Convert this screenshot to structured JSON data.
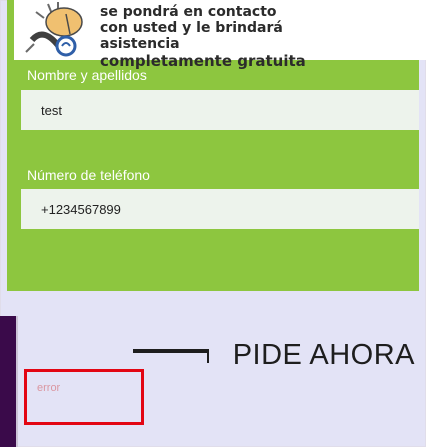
{
  "header": {
    "line1": "se pondrá en contacto",
    "line2": "con usted y le brindará",
    "line3": "asistencia",
    "line4": "completamente gratuita"
  },
  "form": {
    "name_label": "Nombre y apellidos",
    "name_value": "test",
    "phone_label": "Número de teléfono",
    "phone_value": "+1234567899",
    "submit_label": "PIDE AHORA"
  },
  "overlay": {
    "ghost_text": "error"
  },
  "colors": {
    "form_background": "#8dc63f",
    "field_background": "#edf3ec",
    "highlight_border": "#e30613",
    "sidebar": "#3a0a4a"
  },
  "icons": [
    "phone-ring-icon",
    "arrow-right-icon"
  ]
}
